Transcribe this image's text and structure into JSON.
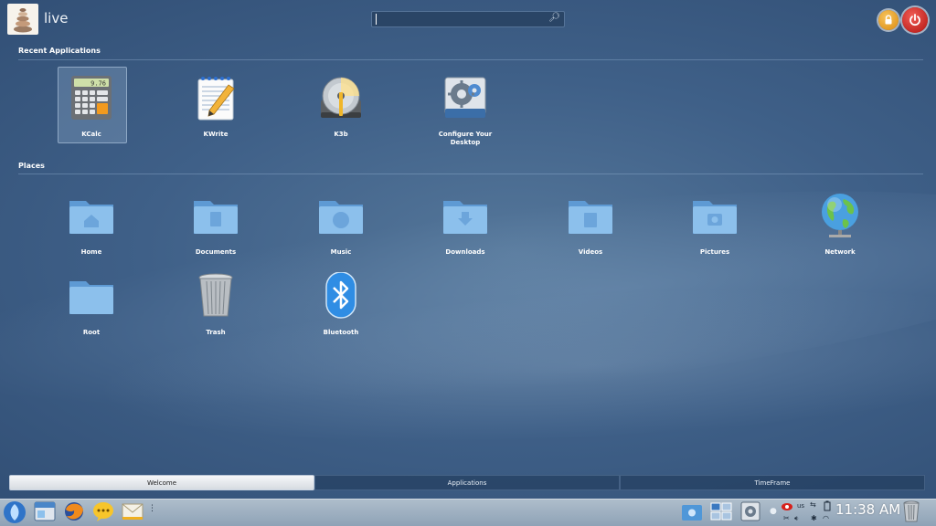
{
  "header": {
    "username": "live",
    "search_value": ""
  },
  "sections": {
    "recent_title": "Recent Applications",
    "places_title": "Places"
  },
  "recent_apps": [
    {
      "label": "KCalc",
      "icon": "calculator-icon",
      "display": "9.76"
    },
    {
      "label": "KWrite",
      "icon": "text-editor-icon"
    },
    {
      "label": "K3b",
      "icon": "disc-burner-icon"
    },
    {
      "label": "Configure Your Desktop",
      "icon": "system-settings-icon"
    }
  ],
  "places": [
    {
      "label": "Home",
      "icon": "home-folder-icon"
    },
    {
      "label": "Documents",
      "icon": "documents-folder-icon"
    },
    {
      "label": "Music",
      "icon": "music-folder-icon"
    },
    {
      "label": "Downloads",
      "icon": "downloads-folder-icon"
    },
    {
      "label": "Videos",
      "icon": "videos-folder-icon"
    },
    {
      "label": "Pictures",
      "icon": "pictures-folder-icon"
    },
    {
      "label": "Network",
      "icon": "network-globe-icon"
    },
    {
      "label": "Root",
      "icon": "root-folder-icon"
    },
    {
      "label": "Trash",
      "icon": "trash-icon"
    },
    {
      "label": "Bluetooth",
      "icon": "bluetooth-icon"
    }
  ],
  "tabs": [
    {
      "label": "Welcome",
      "active": true
    },
    {
      "label": "Applications",
      "active": false
    },
    {
      "label": "TimeFrame",
      "active": false
    }
  ],
  "taskbar": {
    "clock": "11:38 AM",
    "keyboard_layout": "us",
    "launchers": [
      "app-launcher-icon",
      "file-manager-icon",
      "firefox-icon",
      "chat-icon",
      "mail-icon"
    ],
    "colors": {
      "accent": "#3f6088",
      "taskbar": "#9fb0c2",
      "power": "#d0221c",
      "lock": "#e8a42d"
    }
  }
}
